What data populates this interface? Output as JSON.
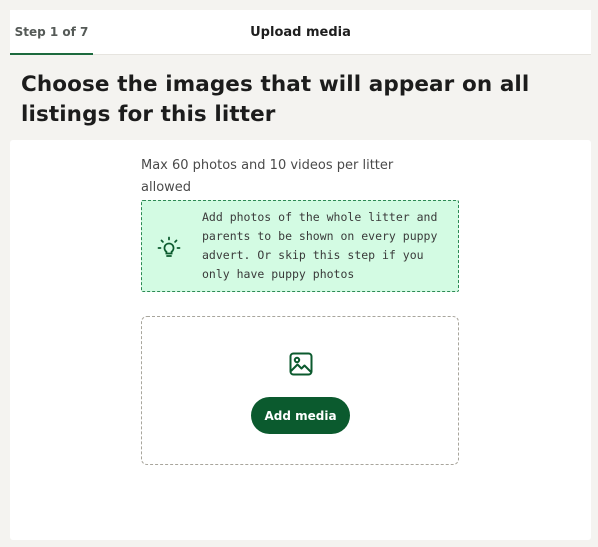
{
  "header": {
    "step_label": "Step 1 of 7",
    "title": "Upload media"
  },
  "page": {
    "heading": "Choose the images that will appear on all listings for this litter",
    "limit_text": "Max 60 photos and 10 videos per litter allowed"
  },
  "tip": {
    "icon": "lightbulb-icon",
    "text": "Add photos of the whole litter and parents to be shown on every puppy advert. Or skip this step if you only have puppy photos"
  },
  "upload": {
    "icon": "image-icon",
    "button_label": "Add media"
  },
  "colors": {
    "accent": "#0b5a2e",
    "tip_background": "#d3fbe3",
    "page_background": "#f4f3f0"
  }
}
